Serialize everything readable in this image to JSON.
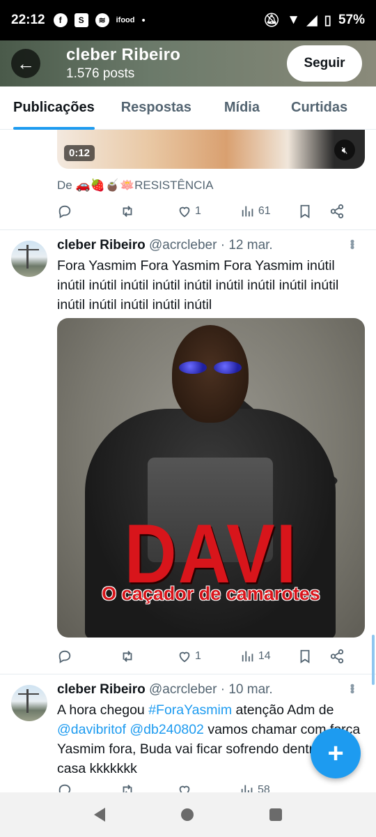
{
  "status_bar": {
    "time": "22:12",
    "battery": "57%"
  },
  "profile": {
    "name": "cleber Ribeiro",
    "posts": "1.576 posts",
    "follow_label": "Seguir"
  },
  "tabs": [
    {
      "label": "Publicações",
      "active": true
    },
    {
      "label": "Respostas",
      "active": false
    },
    {
      "label": "Mídia",
      "active": false
    },
    {
      "label": "Curtidas",
      "active": false
    }
  ],
  "prev_tweet": {
    "video_time": "0:12",
    "from_line": "De 🚗🍓🧉🪷RESISTÊNCIA",
    "likes": "1",
    "views": "61"
  },
  "tweet1": {
    "name": "cleber Ribeiro",
    "handle": "@acrcleber",
    "date": "· 12 mar.",
    "text": "Fora Yasmim Fora Yasmim Fora Yasmim inútil inútil inútil inútil inútil inútil inútil inútil inútil inútil inútil inútil inútil inútil inútil",
    "media_title": "DAVI",
    "media_subtitle": "O caçador de camarotes",
    "likes": "1",
    "views": "14"
  },
  "tweet2": {
    "name": "cleber Ribeiro",
    "handle": "@acrcleber",
    "date": "· 10 mar.",
    "text_a": "A hora chegou ",
    "hashtag": "#ForaYasmim",
    "text_b": " atenção Adm de ",
    "mention1": "@davibritof",
    "mention2": "@db240802",
    "text_c": " vamos chamar com força Yasmim fora, Buda vai ficar sofrendo dentro da casa kkkkkkk",
    "views": "58"
  },
  "fab_label": "+",
  "colors": {
    "accent": "#1d9bf0",
    "text": "#0f1419",
    "muted": "#536471"
  }
}
